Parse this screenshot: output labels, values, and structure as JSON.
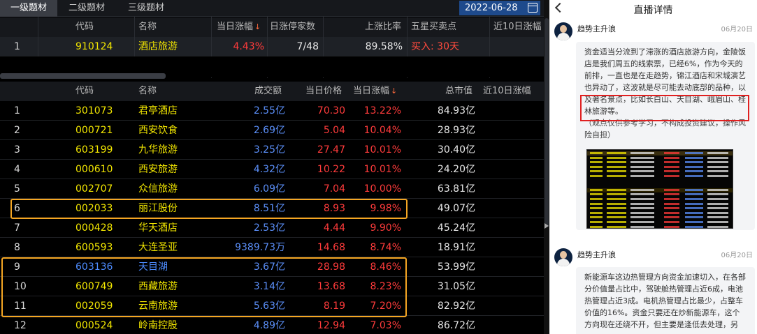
{
  "tabs": [
    "一级题材",
    "二级题材",
    "三级题材"
  ],
  "date": "2022-06-28",
  "sector_table": {
    "headers": [
      "代码",
      "名称",
      "当日涨幅",
      "日涨停家数",
      "上涨比率",
      "五星买卖点",
      "近10日涨幅"
    ],
    "sort_arrow": "↓",
    "row": {
      "idx": "1",
      "code": "910124",
      "name": "酒店旅游",
      "chg": "4.43%",
      "limit_up": "7/48",
      "ratio": "89.58%",
      "signal": "买入: 30天"
    }
  },
  "stock_table": {
    "headers": [
      "代码",
      "名称",
      "成交额",
      "当日价格",
      "当日涨幅",
      "总市值",
      "近10日涨幅"
    ],
    "sort_arrow": "↓",
    "rows": [
      {
        "idx": "1",
        "code": "301073",
        "name": "君亭酒店",
        "amount": "2.55亿",
        "price": "70.30",
        "chg": "13.22%",
        "cap": "84.93亿"
      },
      {
        "idx": "2",
        "code": "000721",
        "name": "西安饮食",
        "amount": "2.69亿",
        "price": "5.04",
        "chg": "10.04%",
        "cap": "28.93亿"
      },
      {
        "idx": "3",
        "code": "603199",
        "name": "九华旅游",
        "amount": "3.25亿",
        "price": "27.47",
        "chg": "10.01%",
        "cap": "30.40亿"
      },
      {
        "idx": "4",
        "code": "000610",
        "name": "西安旅游",
        "amount": "4.32亿",
        "price": "10.22",
        "chg": "10.01%",
        "cap": "24.20亿"
      },
      {
        "idx": "5",
        "code": "002707",
        "name": "众信旅游",
        "amount": "6.09亿",
        "price": "7.04",
        "chg": "10.00%",
        "cap": "63.81亿"
      },
      {
        "idx": "6",
        "code": "002033",
        "name": "丽江股份",
        "amount": "8.51亿",
        "price": "8.93",
        "chg": "9.98%",
        "cap": "49.07亿"
      },
      {
        "idx": "7",
        "code": "000428",
        "name": "华天酒店",
        "amount": "2.53亿",
        "price": "4.44",
        "chg": "9.90%",
        "cap": "45.24亿"
      },
      {
        "idx": "8",
        "code": "600593",
        "name": "大连圣亚",
        "amount": "9389.73万",
        "price": "14.68",
        "chg": "8.74%",
        "cap": "18.91亿"
      },
      {
        "idx": "9",
        "code": "603136",
        "name": "天目湖",
        "amount": "3.67亿",
        "price": "28.98",
        "chg": "8.46%",
        "cap": "53.99亿"
      },
      {
        "idx": "10",
        "code": "600749",
        "name": "西藏旅游",
        "amount": "3.14亿",
        "price": "13.68",
        "chg": "8.23%",
        "cap": "31.05亿"
      },
      {
        "idx": "11",
        "code": "002059",
        "name": "云南旅游",
        "amount": "5.63亿",
        "price": "8.19",
        "chg": "7.20%",
        "cap": "82.92亿"
      },
      {
        "idx": "12",
        "code": "000524",
        "name": "岭南控股",
        "amount": "4.89亿",
        "price": "12.94",
        "chg": "7.03%",
        "cap": "86.72亿"
      }
    ]
  },
  "colors": {
    "code_yellow": "#f2e600",
    "up_red": "#ff3b3b",
    "amount_blue": "#5b8ff9",
    "highlight_orange": "#f5a623",
    "date_blue": "#1e4a8c"
  },
  "panel": {
    "title": "直播详情",
    "posts": [
      {
        "author": "趋势主升浪",
        "date": "06月20日",
        "text": "资金适当分流到了滞涨的酒店旅游方向，金陵饭店是我们周五的线索票，已经6%，作为今天的前排，一直也是在走趋势，锦江酒店和宋城演艺也异动了，这波就是尽可能去动底部的品种，以及著名景点，比如长白山、天目湖、峨眉山、桂林旅游等。",
        "disclaimer": "（观点仅供参考学习，不构成投资建议，操作风险自担）"
      },
      {
        "author": "趋势主升浪",
        "date": "06月20日",
        "text": "新能源车这边热管理方向资金加速切入，在各部分价值量占比中，驾驶舱热管理占近6成，电池热管理占近3成。电机热管理占比最少，占整车价值的16%。资金只要还在炒新能源车，这个方向现在还绕不开，但主要是逢低去处理，另"
      }
    ]
  }
}
